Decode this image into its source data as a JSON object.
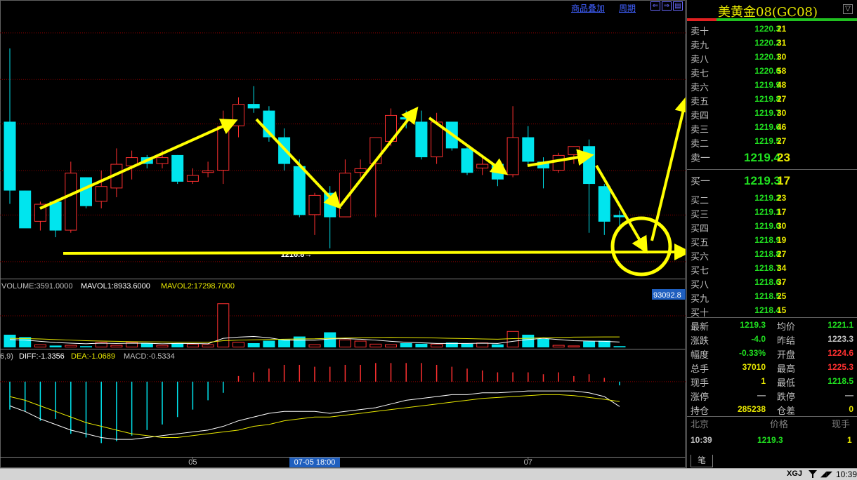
{
  "toolbar": {
    "overlay_label": "商品叠加",
    "period_label": "周期",
    "nav_left": "⇐",
    "nav_right": "⇒",
    "nav_menu": "▤"
  },
  "colors": {
    "up": "#ff3030",
    "down": "#00e5ee",
    "grid": "#8b0000",
    "annotation": "#ffff00",
    "mavol1": "#ffffff",
    "mavol2": "#e8e800",
    "dea": "#e8e800",
    "diff": "#ffffff",
    "price_green": "#20e020",
    "price_red": "#ff3030",
    "qty_yellow": "#e8e800"
  },
  "chart_data": [
    {
      "type": "candlestick",
      "panel": "price",
      "ylim": [
        1215.5,
        1227.6
      ],
      "gridlines": [
        1216.2,
        1218.3,
        1220.3,
        1222.4,
        1224.4,
        1226.5
      ],
      "x_tick_labels": [
        {
          "label": "05",
          "index": 12
        },
        {
          "label": "07-05 18:00",
          "index": 20,
          "highlight": true
        },
        {
          "label": "07",
          "index": 34
        }
      ],
      "low_marker": {
        "label": "1216.8→",
        "value": 1216.8,
        "index": 21
      },
      "candles": [
        {
          "o": 1222.5,
          "h": 1225.8,
          "l": 1218.8,
          "c": 1219.4
        },
        {
          "o": 1219.4,
          "h": 1219.4,
          "l": 1217.9,
          "c": 1217.7
        },
        {
          "o": 1218.0,
          "h": 1218.9,
          "l": 1217.6,
          "c": 1218.8
        },
        {
          "o": 1218.9,
          "h": 1218.9,
          "l": 1217.3,
          "c": 1217.6
        },
        {
          "o": 1217.6,
          "h": 1220.7,
          "l": 1217.5,
          "c": 1220.2
        },
        {
          "o": 1220.0,
          "h": 1220.0,
          "l": 1218.6,
          "c": 1218.7
        },
        {
          "o": 1218.9,
          "h": 1220.3,
          "l": 1218.6,
          "c": 1219.6
        },
        {
          "o": 1219.5,
          "h": 1221.3,
          "l": 1219.1,
          "c": 1220.6
        },
        {
          "o": 1220.5,
          "h": 1221.2,
          "l": 1219.9,
          "c": 1220.9
        },
        {
          "o": 1220.9,
          "h": 1221.0,
          "l": 1220.4,
          "c": 1220.6
        },
        {
          "o": 1220.6,
          "h": 1221.2,
          "l": 1220.4,
          "c": 1220.9
        },
        {
          "o": 1221.0,
          "h": 1221.0,
          "l": 1219.7,
          "c": 1219.8
        },
        {
          "o": 1219.8,
          "h": 1220.4,
          "l": 1219.7,
          "c": 1220.1
        },
        {
          "o": 1220.2,
          "h": 1220.7,
          "l": 1220.0,
          "c": 1220.3
        },
        {
          "o": 1220.3,
          "h": 1223.0,
          "l": 1219.7,
          "c": 1222.3
        },
        {
          "o": 1222.3,
          "h": 1223.6,
          "l": 1221.8,
          "c": 1223.3
        },
        {
          "o": 1223.3,
          "h": 1224.1,
          "l": 1222.9,
          "c": 1223.1
        },
        {
          "o": 1223.0,
          "h": 1223.2,
          "l": 1221.6,
          "c": 1221.8
        },
        {
          "o": 1221.8,
          "h": 1222.2,
          "l": 1220.3,
          "c": 1220.6
        },
        {
          "o": 1220.5,
          "h": 1220.8,
          "l": 1218.2,
          "c": 1218.3
        },
        {
          "o": 1218.3,
          "h": 1219.3,
          "l": 1217.4,
          "c": 1219.2
        },
        {
          "o": 1219.3,
          "h": 1219.6,
          "l": 1216.8,
          "c": 1218.2
        },
        {
          "o": 1218.2,
          "h": 1220.8,
          "l": 1218.2,
          "c": 1220.2
        },
        {
          "o": 1220.2,
          "h": 1220.8,
          "l": 1220.0,
          "c": 1220.4
        },
        {
          "o": 1220.6,
          "h": 1221.7,
          "l": 1218.2,
          "c": 1221.8
        },
        {
          "o": 1221.6,
          "h": 1223.1,
          "l": 1221.4,
          "c": 1222.8
        },
        {
          "o": 1222.7,
          "h": 1223.0,
          "l": 1222.2,
          "c": 1222.6
        },
        {
          "o": 1222.5,
          "h": 1223.0,
          "l": 1220.8,
          "c": 1220.9
        },
        {
          "o": 1220.9,
          "h": 1222.9,
          "l": 1220.6,
          "c": 1222.5
        },
        {
          "o": 1222.5,
          "h": 1222.5,
          "l": 1221.2,
          "c": 1221.3
        },
        {
          "o": 1221.3,
          "h": 1221.5,
          "l": 1220.1,
          "c": 1220.2
        },
        {
          "o": 1220.4,
          "h": 1221.0,
          "l": 1220.1,
          "c": 1220.6
        },
        {
          "o": 1220.6,
          "h": 1220.7,
          "l": 1219.6,
          "c": 1219.9
        },
        {
          "o": 1220.1,
          "h": 1223.2,
          "l": 1220.0,
          "c": 1221.8
        },
        {
          "o": 1221.8,
          "h": 1222.3,
          "l": 1220.5,
          "c": 1220.7
        },
        {
          "o": 1220.7,
          "h": 1220.9,
          "l": 1219.5,
          "c": 1220.4
        },
        {
          "o": 1220.3,
          "h": 1221.1,
          "l": 1220.2,
          "c": 1221.0
        },
        {
          "o": 1221.0,
          "h": 1221.2,
          "l": 1220.6,
          "c": 1221.4
        },
        {
          "o": 1221.4,
          "h": 1221.7,
          "l": 1217.5,
          "c": 1219.7
        },
        {
          "o": 1219.6,
          "h": 1219.7,
          "l": 1217.4,
          "c": 1218.0
        },
        {
          "o": 1218.3,
          "h": 1218.5,
          "l": 1217.7,
          "c": 1218.2
        }
      ]
    },
    {
      "type": "bar",
      "panel": "volume",
      "label_volume": "VOLUME:3591.0000",
      "label_mavol1": "MAVOL1:8933.6000",
      "label_mavol2": "MAVOL2:17298.7000",
      "max_label": "93092.8",
      "ylim": [
        0,
        93092.8
      ],
      "values": [
        21000,
        17000,
        5000,
        3000,
        4000,
        2000,
        9000,
        4000,
        9000,
        7000,
        4000,
        7000,
        6000,
        5000,
        73000,
        9000,
        7000,
        11000,
        13000,
        18000,
        5000,
        25000,
        13000,
        11000,
        6000,
        5000,
        7000,
        6000,
        6000,
        8000,
        6000,
        8000,
        5000,
        27000,
        21000,
        14000,
        4000,
        3000,
        10000,
        11000,
        2000
      ],
      "mavol1": [
        13000,
        12000,
        10000,
        8000,
        7000,
        6000,
        7000,
        6500,
        7000,
        6800,
        6000,
        6500,
        6400,
        6000,
        15000,
        17000,
        18000,
        16000,
        12000,
        12000,
        12000,
        14000,
        14500,
        13500,
        12000,
        10000,
        8500,
        7500,
        6500,
        6600,
        6500,
        7000,
        6500,
        10000,
        13000,
        15000,
        13000,
        11000,
        10500,
        10000,
        8900
      ],
      "mavol2": [
        15000,
        14500,
        14000,
        13000,
        12000,
        11000,
        10500,
        10000,
        9500,
        9200,
        9000,
        8800,
        8700,
        8500,
        11000,
        12000,
        12500,
        13000,
        13500,
        14000,
        14200,
        15000,
        15500,
        16000,
        16500,
        16800,
        16500,
        16000,
        15500,
        15000,
        14500,
        14000,
        13500,
        14500,
        15000,
        16000,
        16500,
        17000,
        17200,
        17300,
        17300
      ]
    },
    {
      "type": "bar",
      "panel": "macd",
      "label_params": "6,9)",
      "label_diff": "DIFF:-1.3356",
      "label_dea": "DEA:-1.0689",
      "label_macd": "MACD:-0.5334",
      "ylim": [
        -4.0,
        1.2
      ],
      "macd": [
        -1.5,
        -1.6,
        -2.1,
        -2.0,
        -2.8,
        -3.0,
        -3.3,
        -3.2,
        -2.9,
        -2.6,
        -2.3,
        -1.9,
        -1.5,
        -1.0,
        -0.6,
        0.3,
        0.5,
        0.7,
        0.9,
        0.9,
        0.8,
        0.8,
        0.9,
        0.9,
        1.0,
        1.0,
        1.0,
        1.0,
        0.9,
        0.8,
        0.7,
        0.6,
        0.5,
        0.5,
        0.5,
        0.4,
        0.5,
        0.3,
        0.4,
        0.2,
        -0.2
      ],
      "diff": [
        -1.3,
        -1.6,
        -2.0,
        -2.3,
        -2.6,
        -2.8,
        -3.0,
        -3.1,
        -3.1,
        -3.0,
        -2.9,
        -2.8,
        -2.7,
        -2.6,
        -2.4,
        -2.1,
        -1.9,
        -1.7,
        -1.6,
        -1.6,
        -1.6,
        -1.7,
        -1.6,
        -1.5,
        -1.4,
        -1.2,
        -1.0,
        -0.9,
        -0.8,
        -0.7,
        -0.7,
        -0.6,
        -0.6,
        -0.55,
        -0.5,
        -0.5,
        -0.5,
        -0.5,
        -0.6,
        -0.8,
        -1.3356
      ],
      "dea": [
        -0.8,
        -1.0,
        -1.3,
        -1.6,
        -1.9,
        -2.2,
        -2.4,
        -2.6,
        -2.8,
        -2.9,
        -3.0,
        -3.0,
        -2.9,
        -2.8,
        -2.7,
        -2.6,
        -2.4,
        -2.3,
        -2.1,
        -2.0,
        -1.9,
        -1.9,
        -1.8,
        -1.7,
        -1.6,
        -1.5,
        -1.4,
        -1.3,
        -1.2,
        -1.1,
        -1.0,
        -0.9,
        -0.85,
        -0.8,
        -0.75,
        -0.7,
        -0.7,
        -0.75,
        -0.85,
        -0.95,
        -1.0689
      ]
    }
  ],
  "panel": {
    "title": "美黄金08(GC08)",
    "title_icon": "▽",
    "asks": [
      {
        "label": "卖十",
        "price": "1220.3",
        "qty": "21"
      },
      {
        "label": "卖九",
        "price": "1220.2",
        "qty": "31"
      },
      {
        "label": "卖八",
        "price": "1220.1",
        "qty": "30"
      },
      {
        "label": "卖七",
        "price": "1220.0",
        "qty": "58"
      },
      {
        "label": "卖六",
        "price": "1219.9",
        "qty": "48"
      },
      {
        "label": "卖五",
        "price": "1219.8",
        "qty": "27"
      },
      {
        "label": "卖四",
        "price": "1219.7",
        "qty": "30"
      },
      {
        "label": "卖三",
        "price": "1219.6",
        "qty": "46"
      },
      {
        "label": "卖二",
        "price": "1219.5",
        "qty": "27"
      },
      {
        "label": "卖一",
        "price": "1219.4",
        "qty": "23"
      }
    ],
    "bids": [
      {
        "label": "买一",
        "price": "1219.3",
        "qty": "17"
      },
      {
        "label": "买二",
        "price": "1219.2",
        "qty": "23"
      },
      {
        "label": "买三",
        "price": "1219.1",
        "qty": "17"
      },
      {
        "label": "买四",
        "price": "1219.0",
        "qty": "30"
      },
      {
        "label": "买五",
        "price": "1218.9",
        "qty": "19"
      },
      {
        "label": "买六",
        "price": "1218.8",
        "qty": "27"
      },
      {
        "label": "买七",
        "price": "1218.7",
        "qty": "34"
      },
      {
        "label": "买八",
        "price": "1218.6",
        "qty": "37"
      },
      {
        "label": "买九",
        "price": "1218.5",
        "qty": "25"
      },
      {
        "label": "买十",
        "price": "1218.4",
        "qty": "15"
      }
    ],
    "stats": [
      {
        "l1": "最新",
        "v1": "1219.3",
        "c1": "#20e020",
        "l2": "均价",
        "v2": "1221.1",
        "c2": "#20e020"
      },
      {
        "l1": "涨跌",
        "v1": "-4.0",
        "c1": "#20e020",
        "l2": "昨结",
        "v2": "1223.3",
        "c2": "#c0c0c0"
      },
      {
        "l1": "幅度",
        "v1": "-0.33%",
        "c1": "#20e020",
        "l2": "开盘",
        "v2": "1224.6",
        "c2": "#ff3030"
      },
      {
        "l1": "总手",
        "v1": "37010",
        "c1": "#e8e800",
        "l2": "最高",
        "v2": "1225.3",
        "c2": "#ff3030"
      },
      {
        "l1": "现手",
        "v1": "1",
        "c1": "#e8e800",
        "l2": "最低",
        "v2": "1218.5",
        "c2": "#20e020"
      },
      {
        "l1": "涨停",
        "v1": "—",
        "c1": "#c0c0c0",
        "l2": "跌停",
        "v2": "—",
        "c2": "#c0c0c0"
      },
      {
        "l1": "持仓",
        "v1": "285238",
        "c1": "#e8e800",
        "l2": "仓差",
        "v2": "0",
        "c2": "#e8e800"
      }
    ],
    "tick_header": {
      "place": "北京",
      "price": "价格",
      "qty": "现手"
    },
    "tick_row": {
      "time": "10:39",
      "price": "1219.3",
      "qty": "1"
    },
    "tab": "笔"
  },
  "statusbar": {
    "brand": "XGJ",
    "time": "10:39"
  }
}
